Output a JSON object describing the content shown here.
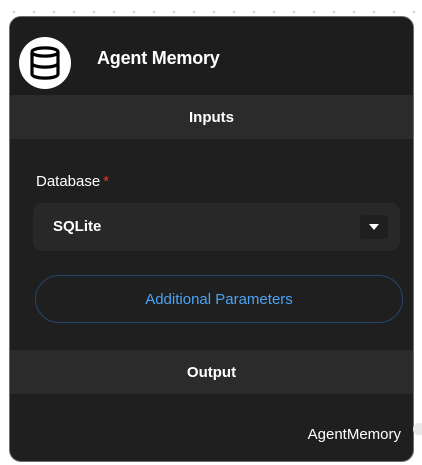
{
  "node": {
    "title": "Agent Memory",
    "icon": "database-icon",
    "inputs_section": "Inputs",
    "output_section": "Output"
  },
  "fields": {
    "database": {
      "label": "Database",
      "required_mark": "*",
      "value": "SQLite"
    }
  },
  "buttons": {
    "additional_parameters": "Additional Parameters"
  },
  "outputs": {
    "agent_memory": "AgentMemory"
  },
  "colors": {
    "node_background": "#1f1f1f",
    "section_bar": "#2b2b2b",
    "accent_link": "#4aa3f5",
    "required": "#e53935"
  }
}
